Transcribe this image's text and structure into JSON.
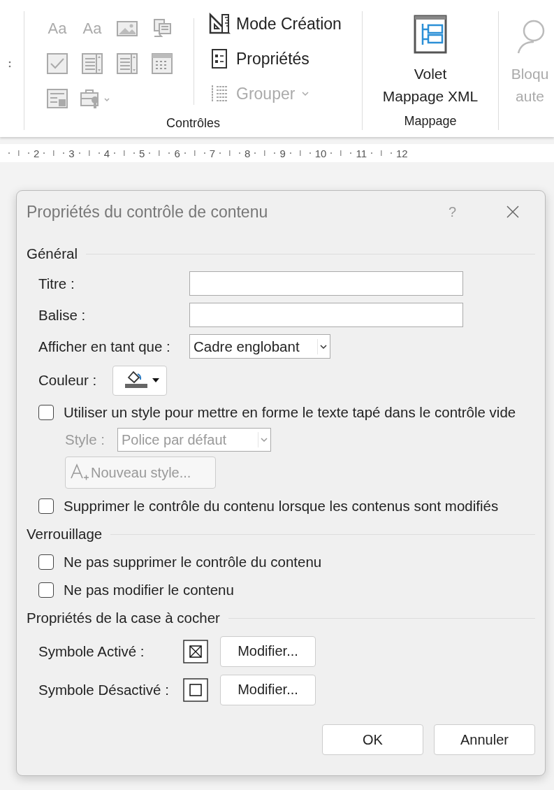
{
  "ribbon": {
    "controls_group": {
      "label": "Contrôles",
      "gallery": [
        {
          "kind": "glyph",
          "text": "Aa"
        },
        {
          "kind": "glyph",
          "text": "Aa"
        },
        {
          "kind": "image"
        },
        {
          "kind": "building-block"
        },
        {
          "kind": "checkbox"
        },
        {
          "kind": "combo"
        },
        {
          "kind": "list"
        },
        {
          "kind": "date"
        },
        {
          "kind": "repeat"
        },
        {
          "kind": "tools"
        }
      ],
      "commands": [
        {
          "kind": "design",
          "label": "Mode Création",
          "disabled": false
        },
        {
          "kind": "properties",
          "label": "Propriétés",
          "disabled": false
        },
        {
          "kind": "group",
          "label": "Grouper",
          "disabled": true
        }
      ]
    },
    "mapping_group": {
      "label": "Mappage",
      "button_lines": [
        "Volet",
        "Mappage XML"
      ]
    },
    "cut_group": {
      "button_lines": [
        "Bloqu",
        "aute"
      ],
      "disabled": true
    }
  },
  "ruler": {
    "marks": [
      "2",
      "3",
      "4",
      "5",
      "6",
      "7",
      "8",
      "9",
      "10",
      "11",
      "12"
    ]
  },
  "dialog": {
    "title": "Propriétés du contrôle de contenu",
    "help": "?",
    "sections": [
      {
        "title": "Général",
        "items": [
          {
            "kind": "text",
            "label": "Titre :"
          },
          {
            "kind": "text",
            "label": "Balise :"
          },
          {
            "kind": "select",
            "label": "Afficher en tant que :",
            "value": "Cadre englobant"
          },
          {
            "kind": "color",
            "label": "Couleur :"
          },
          {
            "kind": "checkbox",
            "label": "Utiliser un style pour mettre en forme le texte tapé dans le contrôle vide",
            "checked": false
          },
          {
            "kind": "style",
            "label": "Style :",
            "value": "Police par défaut",
            "disabled": true
          },
          {
            "kind": "button",
            "label": "Nouveau style...",
            "disabled": true
          },
          {
            "kind": "checkbox",
            "label": "Supprimer le contrôle du contenu lorsque les contenus sont modifiés",
            "checked": false
          }
        ]
      },
      {
        "title": "Verrouillage",
        "items": [
          {
            "kind": "checkbox",
            "label": "Ne pas supprimer le contrôle du contenu",
            "checked": false
          },
          {
            "kind": "checkbox",
            "label": "Ne pas modifier le contenu",
            "checked": false
          }
        ]
      },
      {
        "title": "Propriétés de la case à cocher",
        "items": [
          {
            "kind": "symbol",
            "label": "Symbole Activé :",
            "checked": true,
            "button": "Modifier..."
          },
          {
            "kind": "symbol",
            "label": "Symbole Désactivé :",
            "checked": false,
            "button": "Modifier..."
          }
        ]
      }
    ],
    "buttons": [
      "OK",
      "Annuler"
    ]
  }
}
